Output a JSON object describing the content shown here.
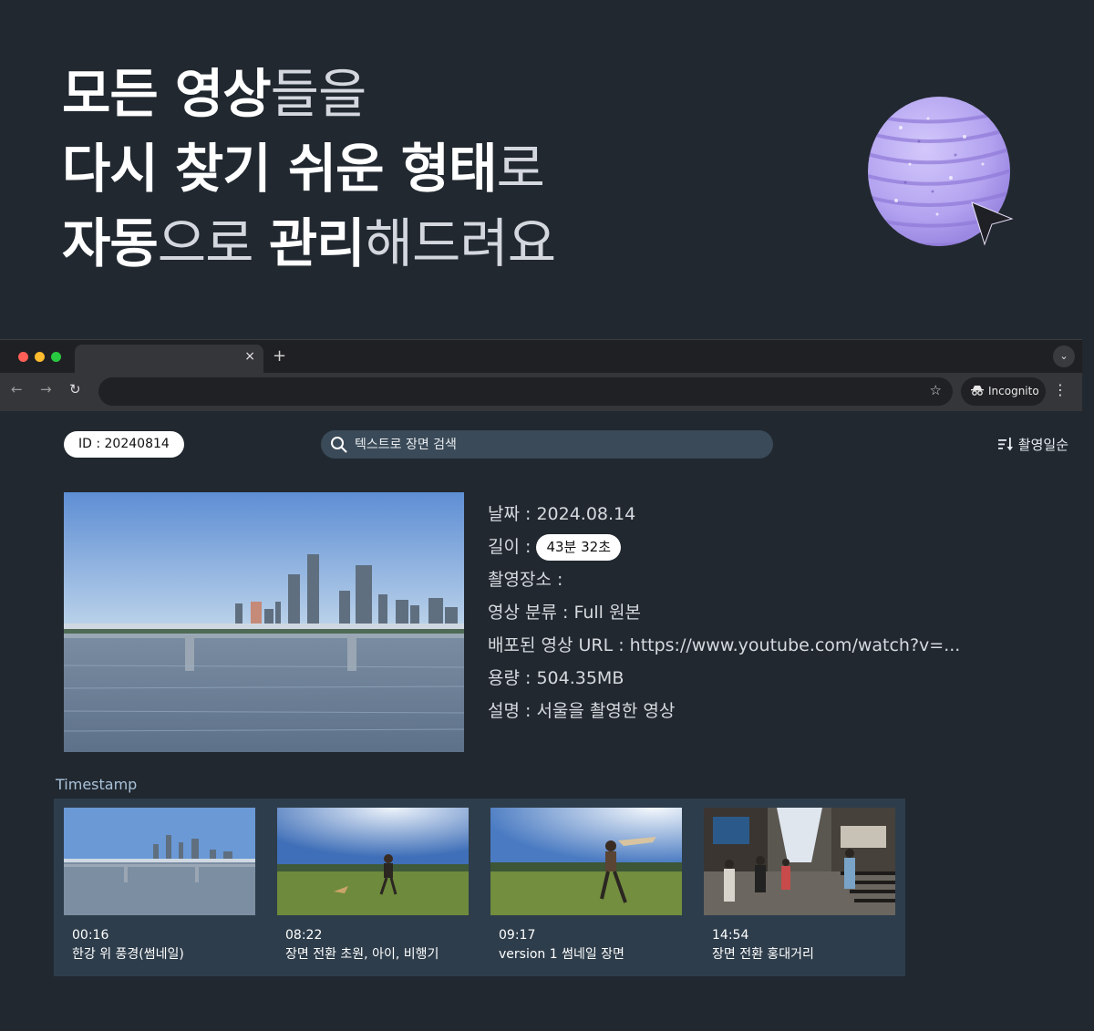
{
  "headline": {
    "line1": [
      {
        "t": "모든 영상",
        "bold": true
      },
      {
        "t": "들을",
        "bold": false
      }
    ],
    "line2": [
      {
        "t": "다시 찾기 쉬운 형태",
        "bold": true
      },
      {
        "t": "로",
        "bold": false
      }
    ],
    "line3": [
      {
        "t": "자동",
        "bold": true
      },
      {
        "t": "으로 ",
        "bold": false
      },
      {
        "t": "관리",
        "bold": true
      },
      {
        "t": "해드려요",
        "bold": false
      }
    ]
  },
  "browser": {
    "tab_close": "×",
    "new_tab": "+",
    "incognito_label": "Incognito",
    "colors": {
      "close": "#ff5f57",
      "minimize": "#febc2e",
      "maximize": "#28c840"
    }
  },
  "app": {
    "id_label": "ID : 20240814",
    "search_placeholder": "텍스트로 장면 검색",
    "sort_label": "촬영일순"
  },
  "meta": {
    "date": "날짜 : 2024.08.14",
    "length_label": "길이 :",
    "length_value": "43분 32초",
    "location": "촬영장소 :",
    "category": "영상 분류 : Full 원본",
    "url": "배포된 영상 URL : https://www.youtube.com/watch?v=...",
    "size": "용량 : 504.35MB",
    "description": "설명 : 서울을 촬영한 영상"
  },
  "timestamp": {
    "label": "Timestamp",
    "items": [
      {
        "time": "00:16",
        "desc": "한강 위 풍경(썸네일)"
      },
      {
        "time": "08:22",
        "desc": "장면 전환 초원, 아이, 비행기"
      },
      {
        "time": "09:17",
        "desc": "version 1 썸네일 장면"
      },
      {
        "time": "14:54",
        "desc": "장면 전환 홍대거리"
      }
    ]
  }
}
